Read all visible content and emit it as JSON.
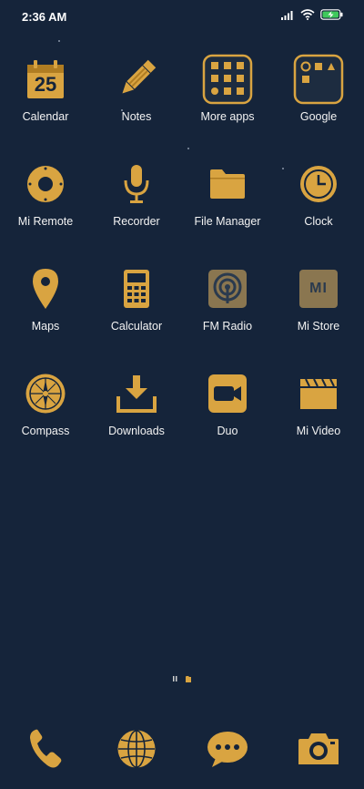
{
  "status_bar": {
    "time": "2:36 AM"
  },
  "apps": [
    {
      "label": "Calendar",
      "day": "25"
    },
    {
      "label": "Notes"
    },
    {
      "label": "More apps"
    },
    {
      "label": "Google"
    },
    {
      "label": "Mi Remote"
    },
    {
      "label": "Recorder"
    },
    {
      "label": "File Manager"
    },
    {
      "label": "Clock"
    },
    {
      "label": "Maps"
    },
    {
      "label": "Calculator"
    },
    {
      "label": "FM Radio"
    },
    {
      "label": "Mi Store",
      "logo": "MI"
    },
    {
      "label": "Compass"
    },
    {
      "label": "Downloads"
    },
    {
      "label": "Duo"
    },
    {
      "label": "Mi Video"
    }
  ],
  "dock": {
    "icons": [
      "phone-icon",
      "browser-icon",
      "messaging-icon",
      "camera-icon"
    ]
  },
  "theme": {
    "background": "#15243a",
    "gold": "#d9a441",
    "gold_dark": "#b07d22"
  }
}
